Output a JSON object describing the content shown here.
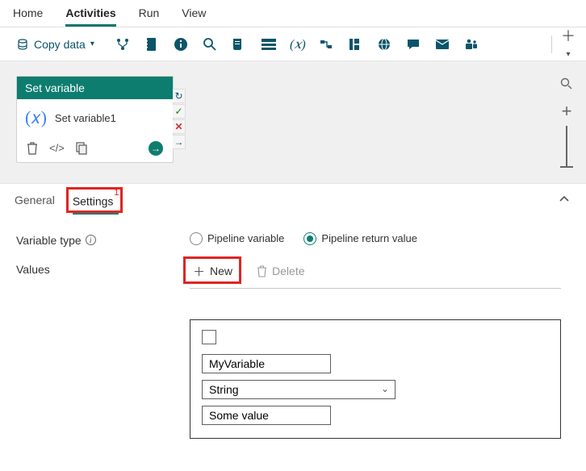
{
  "top_tabs": {
    "home": "Home",
    "activities": "Activities",
    "run": "Run",
    "view": "View"
  },
  "toolbar": {
    "copy_data": "Copy data"
  },
  "activity": {
    "type_label": "Set variable",
    "name": "Set variable1"
  },
  "lower_tabs": {
    "general": "General",
    "settings": "Settings",
    "settings_badge": "1"
  },
  "form": {
    "variable_type_label": "Variable type",
    "values_label": "Values",
    "radio_pipeline_var": "Pipeline variable",
    "radio_return_val": "Pipeline return value",
    "new_btn": "New",
    "delete_btn": "Delete"
  },
  "entry": {
    "name": "MyVariable",
    "type": "String",
    "value": "Some value"
  }
}
